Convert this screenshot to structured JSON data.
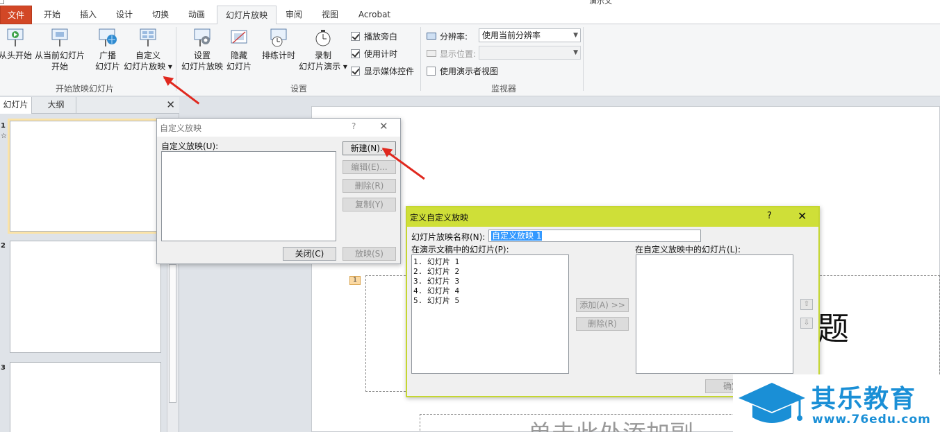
{
  "window": {
    "doc_title": "演示文"
  },
  "tabs": [
    "文件",
    "开始",
    "插入",
    "设计",
    "切换",
    "动画",
    "幻灯片放映",
    "审阅",
    "视图",
    "Acrobat"
  ],
  "active_tab": "幻灯片放映",
  "ribbon": {
    "group_start": {
      "label": "开始放映幻灯片",
      "buttons": [
        {
          "line1": "从头开始",
          "line2": ""
        },
        {
          "line1": "从当前幻灯片",
          "line2": "开始"
        },
        {
          "line1": "广播",
          "line2": "幻灯片"
        },
        {
          "line1": "自定义",
          "line2": "幻灯片放映 ▾"
        }
      ]
    },
    "group_setup": {
      "label": "设置",
      "buttons": [
        {
          "line1": "设置",
          "line2": "幻灯片放映"
        },
        {
          "line1": "隐藏",
          "line2": "幻灯片"
        },
        {
          "line1": "排练计时",
          "line2": ""
        },
        {
          "line1": "录制",
          "line2": "幻灯片演示 ▾"
        }
      ],
      "checkboxes": [
        {
          "label": "播放旁白",
          "checked": true
        },
        {
          "label": "使用计时",
          "checked": true
        },
        {
          "label": "显示媒体控件",
          "checked": true
        }
      ]
    },
    "group_monitors": {
      "label": "监视器",
      "resolution_label": "分辨率:",
      "resolution_value": "使用当前分辨率",
      "show_on_label": "显示位置:",
      "show_on_value": "",
      "presenter_view_label": "使用演示者视图",
      "presenter_view_checked": false
    }
  },
  "left_panel": {
    "tab_slides": "幻灯片",
    "tab_outline": "大纲",
    "close": "✕",
    "slide_numbers": [
      "1",
      "2",
      "3"
    ],
    "star": "☆"
  },
  "slide": {
    "placeholder_badge": "1",
    "title_fragment": "题",
    "subtitle_fragment": "单击此处添加副"
  },
  "dialog_custom_show": {
    "title": "自定义放映",
    "help": "?",
    "close": "✕",
    "list_label": "自定义放映(U):",
    "btn_new": "新建(N)...",
    "btn_edit": "编辑(E)...",
    "btn_delete": "删除(R)",
    "btn_copy": "复制(Y)",
    "btn_close": "关闭(C)",
    "btn_show": "放映(S)"
  },
  "dialog_define": {
    "title": "定义自定义放映",
    "help": "?",
    "close": "✕",
    "name_label": "幻灯片放映名称(N):",
    "name_value": "自定义放映 1",
    "left_list_label": "在演示文稿中的幻灯片(P):",
    "right_list_label": "在自定义放映中的幻灯片(L):",
    "slides": [
      "1. 幻灯片 1",
      "2. 幻灯片 2",
      "3. 幻灯片 3",
      "4. 幻灯片 4",
      "5. 幻灯片 5"
    ],
    "btn_add": "添加(A) >>",
    "btn_remove": "删除(R)",
    "btn_ok": "确定",
    "up_arrow": "⇧",
    "down_arrow": "⇩"
  },
  "watermark": {
    "brand": "其乐教育",
    "url": "www.76edu.com"
  },
  "colors": {
    "file_tab": "#d24726",
    "define_dialog_caption": "#cfdf38",
    "annotation_arrow": "#e0281e",
    "brand_blue": "#1a8fd6"
  }
}
